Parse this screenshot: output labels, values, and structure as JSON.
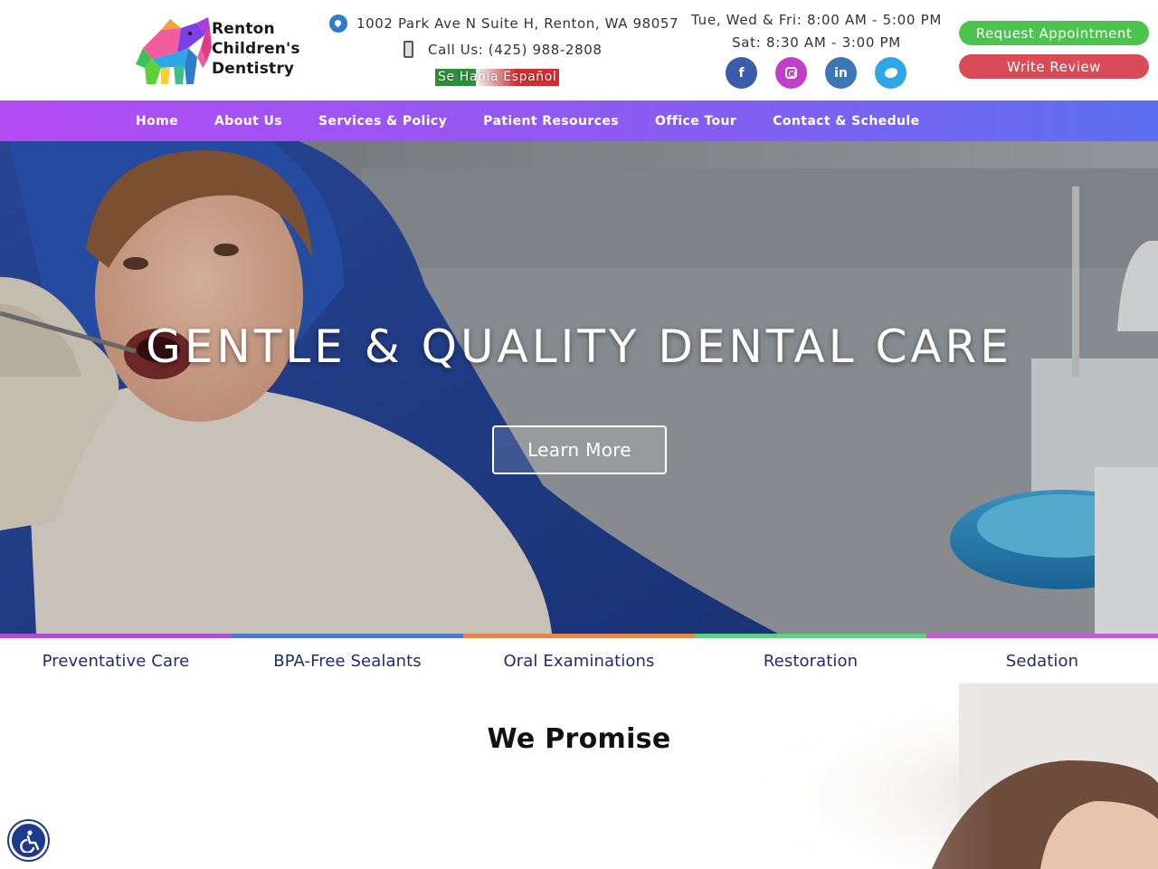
{
  "brand": {
    "name_line1": "Renton",
    "name_line2": "Children's",
    "name_line3": "Dentistry"
  },
  "contact": {
    "address": "1002 Park Ave N Suite H, Renton, WA 98057",
    "phone": "Call Us: (425) 988-2808",
    "spanish": "Se Habla Español"
  },
  "hours": {
    "weekday": "Tue, Wed & Fri: 8:00 AM - 5:00 PM",
    "saturday": "Sat: 8:30 AM - 3:00 PM"
  },
  "social": {
    "facebook": "f",
    "linkedin": "in"
  },
  "cta": {
    "request": "Request Appointment",
    "review": "Write Review"
  },
  "nav": {
    "items": [
      {
        "label": "Home"
      },
      {
        "label": "About Us"
      },
      {
        "label": "Services & Policy"
      },
      {
        "label": "Patient Resources"
      },
      {
        "label": "Office Tour"
      },
      {
        "label": "Contact & Schedule"
      }
    ]
  },
  "hero": {
    "title": "GENTLE & QUALITY DENTAL CARE",
    "button": "Learn More"
  },
  "services": {
    "items": [
      {
        "label": "Preventative Care",
        "color": "#a94fd6"
      },
      {
        "label": "BPA-Free Sealants",
        "color": "#4f77d1"
      },
      {
        "label": "Oral Examinations",
        "color": "#e3874f"
      },
      {
        "label": "Restoration",
        "color": "#5fcf83"
      },
      {
        "label": "Sedation",
        "color": "#c25bd3"
      }
    ]
  },
  "promise": {
    "title": "We Promise"
  },
  "colors": {
    "nav_start": "#b44cf2",
    "nav_end": "#5c6ff0",
    "request_button": "#4cc24f",
    "review_button": "#d94c57",
    "service_text": "#1f2d6b"
  },
  "icons": {
    "address": "map-pin-icon",
    "phone": "phone-icon",
    "accessibility": "accessibility-icon"
  }
}
